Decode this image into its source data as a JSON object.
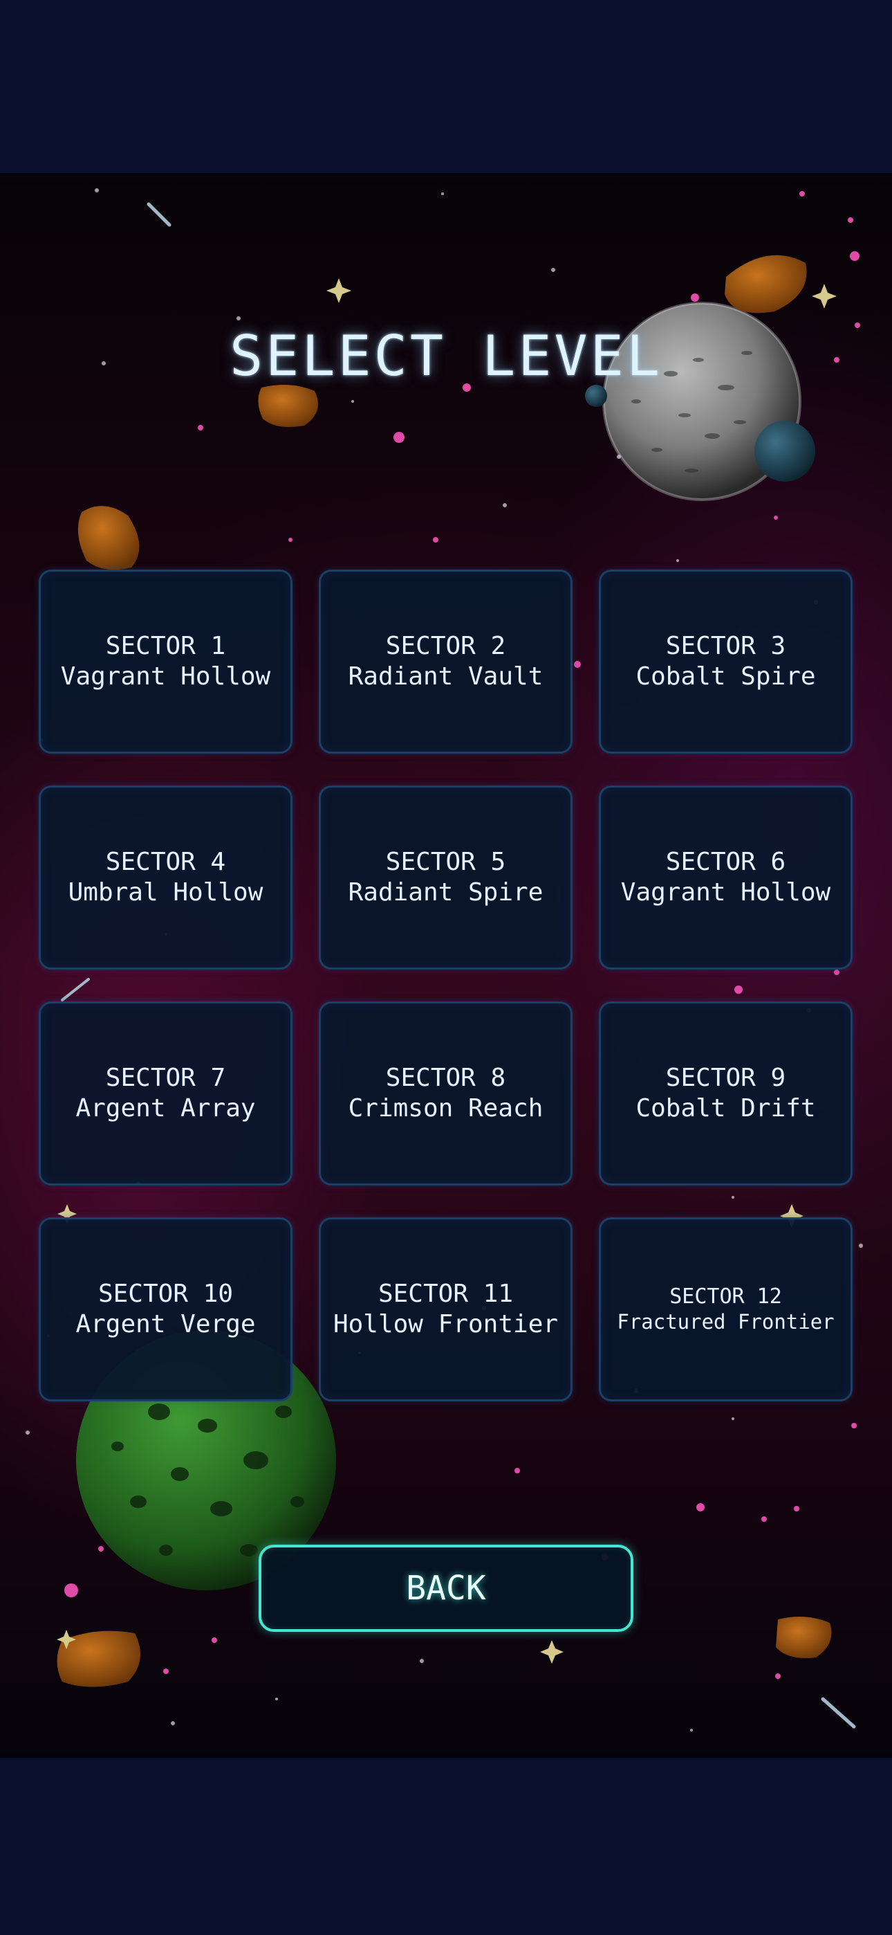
{
  "screen": {
    "title": "SELECT LEVEL"
  },
  "levels": [
    {
      "sector": "SECTOR 1",
      "name": "Vagrant Hollow"
    },
    {
      "sector": "SECTOR 2",
      "name": "Radiant Vault"
    },
    {
      "sector": "SECTOR 3",
      "name": "Cobalt Spire"
    },
    {
      "sector": "SECTOR 4",
      "name": "Umbral Hollow"
    },
    {
      "sector": "SECTOR 5",
      "name": "Radiant Spire"
    },
    {
      "sector": "SECTOR 6",
      "name": "Vagrant Hollow"
    },
    {
      "sector": "SECTOR 7",
      "name": "Argent Array"
    },
    {
      "sector": "SECTOR 8",
      "name": "Crimson Reach"
    },
    {
      "sector": "SECTOR 9",
      "name": "Cobalt Drift"
    },
    {
      "sector": "SECTOR 10",
      "name": "Argent Verge"
    },
    {
      "sector": "SECTOR 11",
      "name": "Hollow Frontier"
    },
    {
      "sector": "SECTOR 12",
      "name": "Fractured Frontier"
    }
  ],
  "back_button": {
    "label": "BACK"
  },
  "colors": {
    "letterbox": "#0a0f2e",
    "tile_background": "#08162c",
    "tile_border": "#1c3f66",
    "tile_text": "#e6f2ff",
    "back_border": "#43e6d0",
    "title_text": "#dff3ff"
  },
  "icons": {
    "background_objects": [
      "gray-planet-icon",
      "small-blue-moon-icon",
      "green-planet-icon",
      "asteroid-icon",
      "star-icon",
      "meteor-streak-icon"
    ]
  }
}
